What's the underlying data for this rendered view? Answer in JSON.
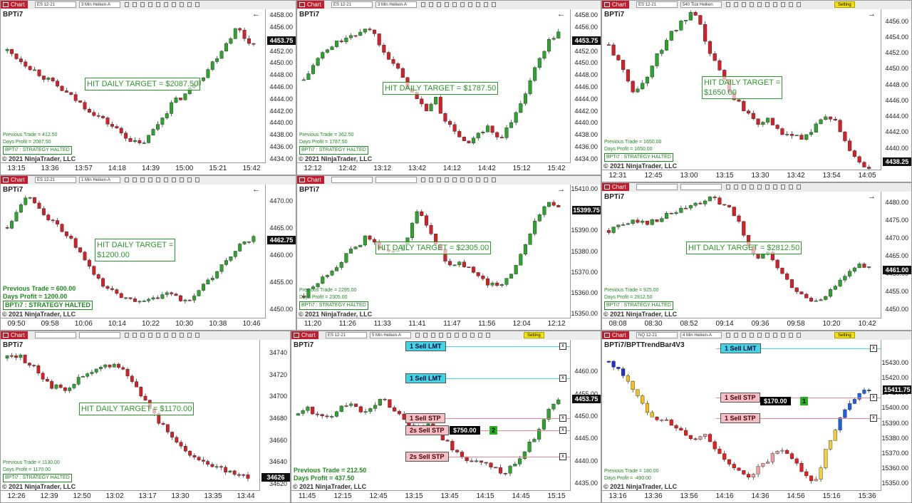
{
  "tab_label": "Chart",
  "setting_label": "Setting",
  "copyright": "© 2021 NinjaTrader, LLC",
  "strategy_halted": "BPTi7 : STRATEGY HALTED",
  "colors": {
    "up": "#2ea32e",
    "down": "#d61f26",
    "target_green": "#2a9a2a",
    "lmt_cyan": "#3fd7e8",
    "stp_pink": "#f4c0c4",
    "setting_yellow": "#f5e400"
  },
  "panels": [
    {
      "instrument": "ES 12-21",
      "bartype": "3 Min Heiken-A",
      "title": "BPTi7",
      "target": "HIT DAILY TARGET = $2087.50",
      "prev": "Previous Trade = 412.50",
      "days": "Days Profit = 2087.50",
      "y_labels": [
        "4458.00",
        "4456.00",
        "4454.00",
        "4452.00",
        "4450.00",
        "4448.00",
        "4446.00",
        "4444.00",
        "4442.00",
        "4440.00",
        "4438.00",
        "4436.00",
        "4434.00"
      ],
      "y_range": [
        4433,
        4459
      ],
      "last_price": "4453.75",
      "x_labels": [
        "13:15",
        "13:36",
        "13:57",
        "14:18",
        "14:39",
        "15:00",
        "15:21",
        "15:42"
      ],
      "chart_data": {
        "type": "candlestick",
        "ylim": [
          4433,
          4459
        ],
        "path": [
          4452,
          4451,
          4450,
          4449,
          4448,
          4447,
          4446,
          4445,
          4444,
          4443,
          4442,
          4441,
          4440,
          4439,
          4438,
          4437,
          4436,
          4437,
          4439,
          4441,
          4443,
          4444,
          4445,
          4447,
          4448,
          4450,
          4452,
          4454,
          4456,
          4454,
          4453
        ]
      }
    },
    {
      "instrument": "ES 12-21",
      "bartype": "3 Min Heiken-A",
      "title": "BPTi7",
      "target": "HIT DAILY TARGET = $1787.50",
      "prev": "Previous Trade = 362.50",
      "days": "Days Profit = 1787.50",
      "y_labels": [
        "4458.00",
        "4456.00",
        "4454.00",
        "4452.00",
        "4450.00",
        "4448.00",
        "4446.00",
        "4444.00",
        "4442.00",
        "4440.00",
        "4438.00",
        "4436.00",
        "4434.00"
      ],
      "y_range": [
        4433,
        4459
      ],
      "last_price": "4453.75",
      "x_labels": [
        "12:12",
        "12:42",
        "13:12",
        "13:42",
        "14:12",
        "14:42",
        "15:12",
        "15:42"
      ],
      "chart_data": {
        "type": "candlestick",
        "ylim": [
          4433,
          4459
        ],
        "path": [
          4447,
          4449,
          4451,
          4452,
          4453,
          4454,
          4454,
          4455,
          4456,
          4455,
          4453,
          4451,
          4449,
          4447,
          4445,
          4443,
          4442,
          4444,
          4441,
          4439,
          4438,
          4436,
          4437,
          4438,
          4439,
          4437,
          4438,
          4440,
          4443,
          4446,
          4449,
          4452,
          4454,
          4455
        ]
      }
    },
    {
      "instrument": "ES 12-21",
      "bartype": "540 Tick Heiken",
      "title": "BPTi7",
      "target": "HIT DAILY TARGET =\n$1650.00",
      "prev": "Previous Trade = 1650.00",
      "days": "Days Profit = 1650.00",
      "y_labels": [
        "4456.00",
        "4454.00",
        "4452.00",
        "4450.00",
        "4448.00",
        "4446.00",
        "4444.00",
        "4442.00",
        "4440.00",
        "4438.00"
      ],
      "y_range": [
        4437,
        4457.5
      ],
      "last_price": "4438.25",
      "x_labels": [
        "12:31",
        "12:45",
        "13:00",
        "13:15",
        "13:30",
        "13:42",
        "13:54",
        "14:05"
      ],
      "chart_data": {
        "type": "candlestick",
        "ylim": [
          4437,
          4457.5
        ],
        "path": [
          4453,
          4451,
          4449,
          4447,
          4448,
          4450,
          4452,
          4454,
          4455,
          4456,
          4457,
          4455,
          4452,
          4450,
          4448,
          4446,
          4445,
          4444,
          4443,
          4444,
          4442,
          4441,
          4442,
          4441,
          4442,
          4443,
          4444,
          4443,
          4441,
          4439,
          4438,
          4437
        ]
      }
    },
    {
      "instrument": "ES 12-21",
      "bartype": "1 Min Heiken-A",
      "title": "BPTi7",
      "target": "HIT DAILY TARGET =\n$1200.00",
      "prev": "Previous Trade = 600.00",
      "days": "Days Profit = 1200.00",
      "y_labels": [
        "4470.00",
        "4465.00",
        "4460.00",
        "4455.00",
        "4450.00"
      ],
      "y_range": [
        4448,
        4473
      ],
      "last_price": "4462.75",
      "x_labels": [
        "09:50",
        "09:58",
        "10:06",
        "10:14",
        "10:22",
        "10:30",
        "10:38",
        "10:46"
      ],
      "chart_data": {
        "type": "candlestick",
        "ylim": [
          4448,
          4473
        ],
        "path": [
          4465,
          4468,
          4471,
          4470,
          4468,
          4466,
          4465,
          4463,
          4461,
          4458,
          4456,
          4454,
          4453,
          4452,
          4452,
          4451,
          4452,
          4451,
          4453,
          4452,
          4451,
          4452,
          4454,
          4455,
          4457,
          4459,
          4461,
          4462,
          4463
        ]
      }
    },
    {
      "instrument": "",
      "bartype": "",
      "title": "BPTi7",
      "target": "HIT DAILY TARGET = $2305.00",
      "prev": "Previous Trade = 2295.00",
      "days": "Days Profit = 2305.00",
      "y_labels": [
        "15410.00",
        "15390.00",
        "15380.00",
        "15370.00",
        "15360.00",
        "15350.00"
      ],
      "y_range": [
        15347,
        15412
      ],
      "last_price": "15399.75",
      "x_labels": [
        "11:20",
        "11:26",
        "11:33",
        "11:41",
        "11:47",
        "11:56",
        "12:04",
        "12:12"
      ],
      "chart_data": {
        "type": "candlestick",
        "ylim": [
          15347,
          15412
        ],
        "path": [
          15358,
          15362,
          15366,
          15370,
          15374,
          15378,
          15382,
          15386,
          15384,
          15380,
          15378,
          15382,
          15388,
          15400,
          15392,
          15384,
          15376,
          15372,
          15374,
          15370,
          15366,
          15364,
          15362,
          15366,
          15372,
          15380,
          15390,
          15400,
          15404,
          15400
        ]
      }
    },
    {
      "instrument": "",
      "bartype": "",
      "title": "BPTi7",
      "target": "HIT DAILY TARGET = $2812.50",
      "prev": "Previous Trade = 925.00",
      "days": "Days Profit = 2812.50",
      "y_labels": [
        "4480.00",
        "4475.00",
        "4470.00",
        "4465.00",
        "4460.00",
        "4455.00",
        "4450.00"
      ],
      "y_range": [
        4447,
        4483
      ],
      "last_price": "4461.00",
      "x_labels": [
        "08:08",
        "08:30",
        "08:52",
        "09:14",
        "09:36",
        "09:58",
        "10:20",
        "10:42"
      ],
      "chart_data": {
        "type": "candlestick",
        "ylim": [
          4447,
          4483
        ],
        "path": [
          4472,
          4473,
          4474,
          4475,
          4474,
          4475,
          4476,
          4477,
          4478,
          4479,
          4480,
          4481,
          4480,
          4478,
          4474,
          4468,
          4464,
          4466,
          4462,
          4458,
          4455,
          4453,
          4452,
          4453,
          4455,
          4458,
          4460,
          4462,
          4461
        ]
      }
    },
    {
      "instrument": "",
      "bartype": "",
      "title": "BPTi7",
      "target": "HIT DAILY TARGET = $1170.00",
      "prev": "Previous Trade = 1130.00",
      "days": "Days Profit = 1170.00",
      "y_labels": [
        "34740",
        "34720",
        "34700",
        "34680",
        "34660",
        "34640",
        "34620"
      ],
      "y_range": [
        34612,
        34752
      ],
      "last_price": "34626",
      "x_labels": [
        "12:26",
        "12:39",
        "12:50",
        "13:02",
        "13:17",
        "13:30",
        "13:35",
        "13:44"
      ],
      "chart_data": {
        "type": "candlestick",
        "ylim": [
          34612,
          34752
        ],
        "path": [
          34735,
          34738,
          34730,
          34720,
          34710,
          34705,
          34712,
          34718,
          34722,
          34728,
          34730,
          34720,
          34705,
          34690,
          34675,
          34660,
          34650,
          34645,
          34640,
          34636,
          34630,
          34628,
          34626
        ]
      }
    },
    {
      "instrument": "ES 12-21",
      "bartype": "5 Min Heiken-A",
      "title": "BPTi7",
      "target": "",
      "prev": "Previous Trade = 212.50",
      "days": "Days Profit = 437.50",
      "y_labels": [
        "4460.00",
        "4455.00",
        "4450.00",
        "4445.00",
        "4440.00",
        "4435.00"
      ],
      "y_range": [
        4433,
        4467
      ],
      "last_price": "4453.75",
      "x_labels": [
        "11:45",
        "12:15",
        "12:45",
        "13:15",
        "13:45",
        "14:15",
        "14:45",
        "15:15"
      ],
      "orders": [
        {
          "label": "1 Sell LMT",
          "kind": "lmt",
          "price": "4465.50",
          "y": 4465.5
        },
        {
          "label": "1 Sell LMT",
          "kind": "lmt",
          "price": "4458.50",
          "y": 4458.5
        },
        {
          "label": "1 Sell STP",
          "kind": "stp",
          "price": "4449.50",
          "y": 4449.5
        },
        {
          "label": "2s Sell STP",
          "kind": "stp",
          "price": "4446.75",
          "y": 4446.75
        },
        {
          "label": "2s Sell STP",
          "kind": "stp",
          "price": "4441.00",
          "y": 4441
        }
      ],
      "pnl": "$750.00",
      "pnl_qty": "2",
      "chart_data": {
        "type": "candlestick",
        "ylim": [
          4433,
          4467
        ],
        "path": [
          4450,
          4452,
          4450,
          4449,
          4451,
          4453,
          4452,
          4450,
          4452,
          4454,
          4452,
          4450,
          4448,
          4447,
          4448,
          4446,
          4444,
          4442,
          4440,
          4439,
          4440,
          4438,
          4437,
          4439,
          4441,
          4444,
          4447,
          4451,
          4454
        ]
      }
    },
    {
      "instrument": "NQ 12-21",
      "bartype": "4 Min Heiken-A",
      "title": "BPTi7/BPTTrendBar4V3",
      "target": "",
      "prev": "Previous Trade = 180.00",
      "days": "Days Profit = -490.00",
      "y_labels": [
        "15430.00",
        "15420.00",
        "15410.00",
        "15400.00",
        "15390.00",
        "15380.00",
        "15370.00",
        "15360.00",
        "15350.00"
      ],
      "y_range": [
        15344,
        15445
      ],
      "last_price": "15411.75",
      "x_labels": [
        "13:16",
        "13:36",
        "13:56",
        "14:16",
        "14:36",
        "14:56",
        "15:16",
        "15:36"
      ],
      "orders": [
        {
          "label": "1 Sell LMT",
          "kind": "lmt",
          "price": "15439.50",
          "y": 15439.5
        },
        {
          "label": "1 Sell STP",
          "kind": "stp",
          "price": "15406.75",
          "y": 15406.75
        },
        {
          "label": "1 Sell STP",
          "kind": "stp",
          "price": "15393.25",
          "y": 15393.25
        }
      ],
      "pnl": "$170.00",
      "pnl_qty": "1",
      "chart_data": {
        "type": "candlestick",
        "ylim": [
          15344,
          15445
        ],
        "path": [
          15430,
          15425,
          15420,
          15410,
          15400,
          15395,
          15392,
          15390,
          15385,
          15380,
          15378,
          15382,
          15375,
          15368,
          15360,
          15356,
          15354,
          15358,
          15362,
          15368,
          15370,
          15365,
          15360,
          15352,
          15350,
          15370,
          15385,
          15395,
          15405,
          15410,
          15412
        ]
      }
    }
  ]
}
